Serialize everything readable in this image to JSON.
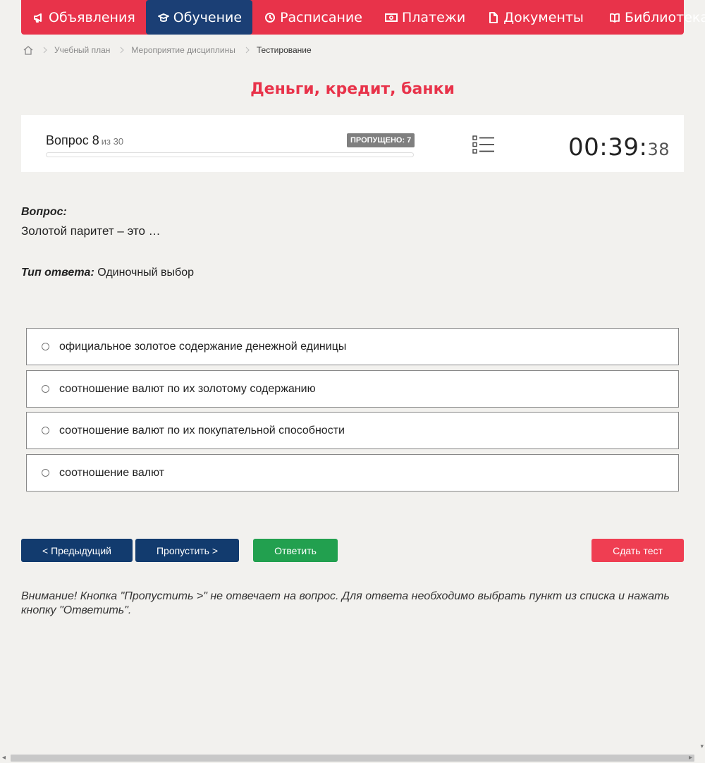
{
  "nav": {
    "items": [
      {
        "label": "Объявления",
        "icon": "megaphone-icon"
      },
      {
        "label": "Обучение",
        "icon": "graduation-cap-icon",
        "active": true
      },
      {
        "label": "Расписание",
        "icon": "clock-icon"
      },
      {
        "label": "Платежи",
        "icon": "money-icon"
      },
      {
        "label": "Документы",
        "icon": "document-icon"
      },
      {
        "label": "Библиотека",
        "icon": "book-icon",
        "dropdown": true
      }
    ]
  },
  "breadcrumb": {
    "items": [
      "Учебный план",
      "Мероприятие дисциплины"
    ],
    "current": "Тестирование"
  },
  "page_title": "Деньги, кредит, банки",
  "progress": {
    "question_label": "Вопрос 8",
    "of_label": "из 30",
    "skipped_label": "ПРОПУЩЕНО: 7",
    "fraction": 0
  },
  "timer": {
    "main": "00:39:",
    "seconds": "38"
  },
  "question": {
    "label": "Вопрос:",
    "text": "Золотой паритет – это …",
    "type_label": "Тип ответа:",
    "type_value": "Одиночный выбор"
  },
  "options": [
    "официальное золотое содержание денежной единицы",
    "соотношение валют по их золотому содержанию",
    "соотношение валют по их покупательной способности",
    "соотношение валют"
  ],
  "buttons": {
    "prev": "< Предыдущий",
    "skip": "Пропустить >",
    "answer": "Ответить",
    "submit": "Сдать тест"
  },
  "note": "Внимание! Кнопка \"Пропустить >\" не отвечает на вопрос. Для ответа необходимо выбрать пункт из списка и нажать кнопку \"Ответить\".",
  "colors": {
    "brand": "#e8334a",
    "nav_active": "#1b3f75",
    "primary_button": "#123b6e",
    "answer_button": "#22a04f",
    "submit_button": "#ef3e52"
  }
}
